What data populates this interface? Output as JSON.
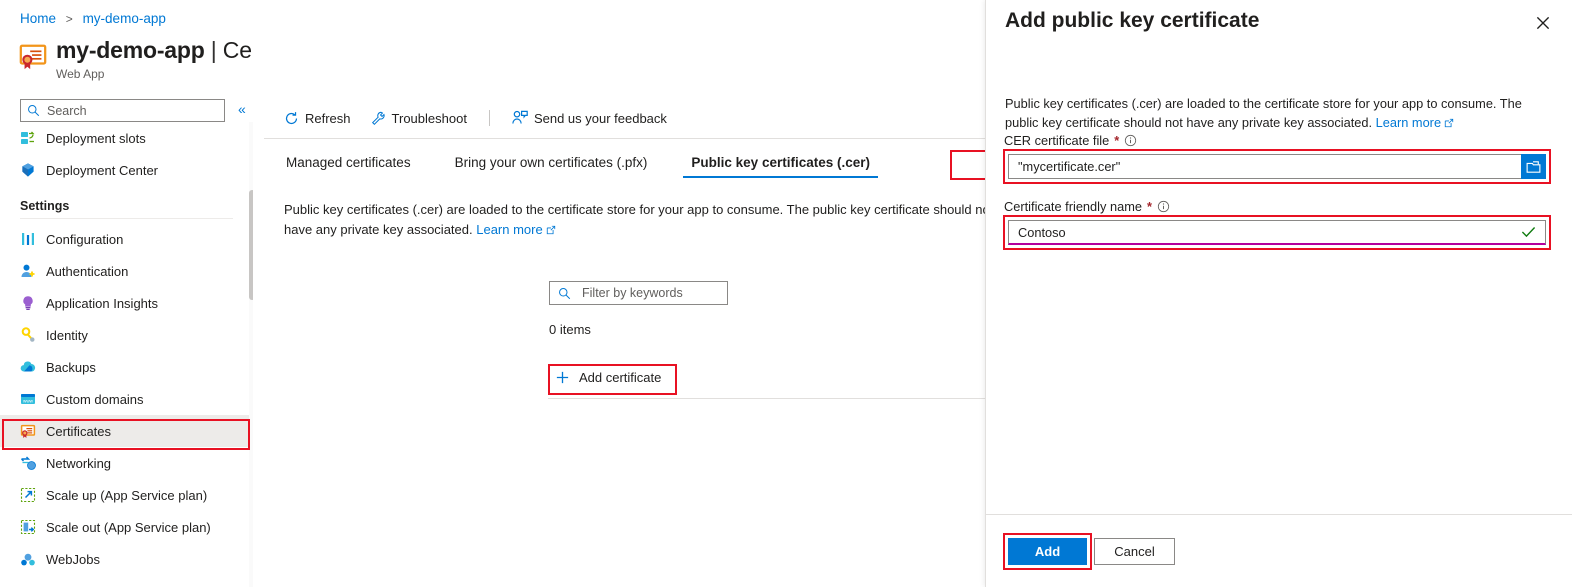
{
  "breadcrumb": {
    "home": "Home",
    "separator": ">",
    "current": "my-demo-app"
  },
  "header": {
    "title_main": "my-demo-app",
    "title_separator": "|",
    "title_sub": "Certificates",
    "subtitle": "Web App",
    "favorite_icon": "star-icon",
    "more_icon": "ellipsis-icon"
  },
  "sidebar": {
    "search": {
      "placeholder": "Search",
      "value": "",
      "icon": "search-icon"
    },
    "collapse_icon": "chevron-double-left-icon",
    "items": [
      {
        "label": "Deployment slots",
        "icon": "deployment-slots-icon",
        "type": "item"
      },
      {
        "label": "Deployment Center",
        "icon": "deployment-center-icon",
        "type": "item"
      },
      {
        "label": "Settings",
        "type": "group"
      },
      {
        "label": "Configuration",
        "icon": "configuration-icon",
        "type": "item"
      },
      {
        "label": "Authentication",
        "icon": "authentication-icon",
        "type": "item"
      },
      {
        "label": "Application Insights",
        "icon": "application-insights-icon",
        "type": "item"
      },
      {
        "label": "Identity",
        "icon": "identity-key-icon",
        "type": "item"
      },
      {
        "label": "Backups",
        "icon": "backups-cloud-icon",
        "type": "item"
      },
      {
        "label": "Custom domains",
        "icon": "custom-domains-icon",
        "type": "item"
      },
      {
        "label": "Certificates",
        "icon": "certificate-icon",
        "type": "item",
        "selected": true
      },
      {
        "label": "Networking",
        "icon": "networking-icon",
        "type": "item"
      },
      {
        "label": "Scale up (App Service plan)",
        "icon": "scale-up-icon",
        "type": "item"
      },
      {
        "label": "Scale out (App Service plan)",
        "icon": "scale-out-icon",
        "type": "item"
      },
      {
        "label": "WebJobs",
        "icon": "webjobs-icon",
        "type": "item"
      }
    ]
  },
  "main": {
    "commands": [
      {
        "label": "Refresh",
        "icon": "refresh-icon"
      },
      {
        "label": "Troubleshoot",
        "icon": "wrench-icon"
      },
      {
        "label": "Send us your feedback",
        "icon": "feedback-person-icon"
      }
    ],
    "tabs": [
      {
        "label": "Managed certificates",
        "active": false
      },
      {
        "label": "Bring your own certificates (.pfx)",
        "active": false
      },
      {
        "label": "Public key certificates (.cer)",
        "active": true
      }
    ],
    "description": "Public key certificates (.cer) are loaded to the certificate store for your app to consume. The public key certificate should not have any private key associated.",
    "description_link": "Learn more",
    "filter": {
      "placeholder": "Filter by keywords",
      "value": "",
      "icon": "search-icon"
    },
    "items_count": "0 items",
    "add_certificate_label": "Add certificate",
    "add_certificate_icon": "plus-icon",
    "empty_art_icon": "certificate-art-icon"
  },
  "panel": {
    "title": "Add public key certificate",
    "close_icon": "close-icon",
    "description": "Public key certificates (.cer) are loaded to the certificate store for your app to consume. The public key certificate should not have any private key associated.",
    "description_link": "Learn more",
    "fields": {
      "cer_file": {
        "label": "CER certificate file",
        "required_marker": "*",
        "info_icon": "info-icon",
        "value": "\"mycertificate.cer\"",
        "browse_icon": "folder-open-icon"
      },
      "friendly_name": {
        "label": "Certificate friendly name",
        "required_marker": "*",
        "info_icon": "info-icon",
        "value": "Contoso",
        "valid_icon": "checkmark-icon"
      }
    },
    "buttons": {
      "primary": "Add",
      "secondary": "Cancel"
    }
  },
  "colors": {
    "accent_blue": "#0078d4",
    "highlight_red": "#e81123",
    "link_blue": "#0078d4",
    "required_red": "#a4262c",
    "valid_green": "#107c10",
    "validation_magenta": "#b4009e",
    "selected_gray": "#edebe9",
    "cert_orange": "#f2951a",
    "cert_red": "#c9282d"
  }
}
